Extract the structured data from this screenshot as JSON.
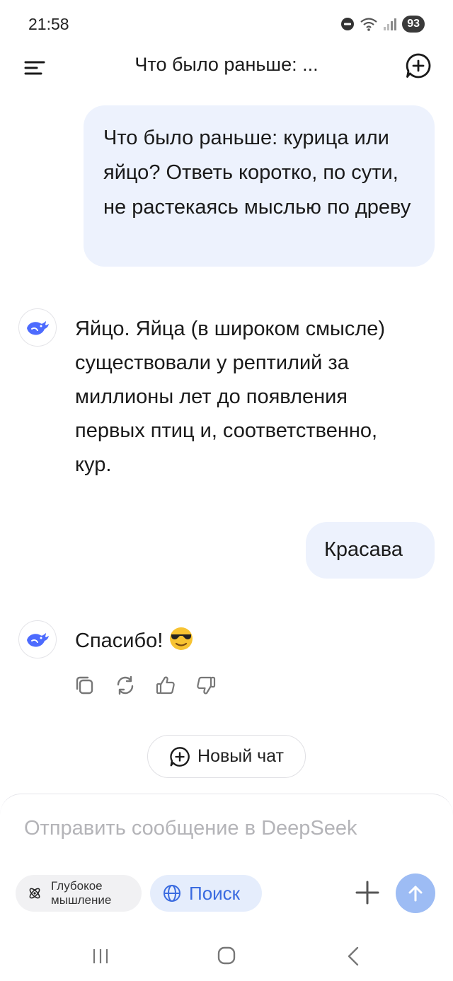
{
  "status_bar": {
    "time": "21:58",
    "battery": "93"
  },
  "header": {
    "title": "Что было раньше: ..."
  },
  "messages": [
    {
      "role": "user",
      "text": "Что было раньше: курица или яйцо? Ответь коротко, по сути, не растекаясь мыслью по древу"
    },
    {
      "role": "assistant",
      "text": "Яйцо. Яйца (в широком смысле) существовали у рептилий за миллионы лет до появления первых птиц и, соответственно, кур."
    },
    {
      "role": "user",
      "text": "Красава"
    },
    {
      "role": "assistant",
      "text": "Спасибо!",
      "emoji": "smiling-face-with-sunglasses"
    }
  ],
  "message_actions": [
    "copy-icon",
    "regenerate-icon",
    "thumbs-up-icon",
    "thumbs-down-icon"
  ],
  "new_chat_label": "Новый чат",
  "composer": {
    "placeholder": "Отправить сообщение в DeepSeek",
    "value": "",
    "deep_thinking_label": "Глубокое мышление",
    "search_label": "Поиск"
  },
  "colors": {
    "user_bubble": "#edf2fd",
    "accent": "#4d6bfe",
    "search_chip_bg": "#e5edfc",
    "send_button": "#9dbcf4"
  }
}
